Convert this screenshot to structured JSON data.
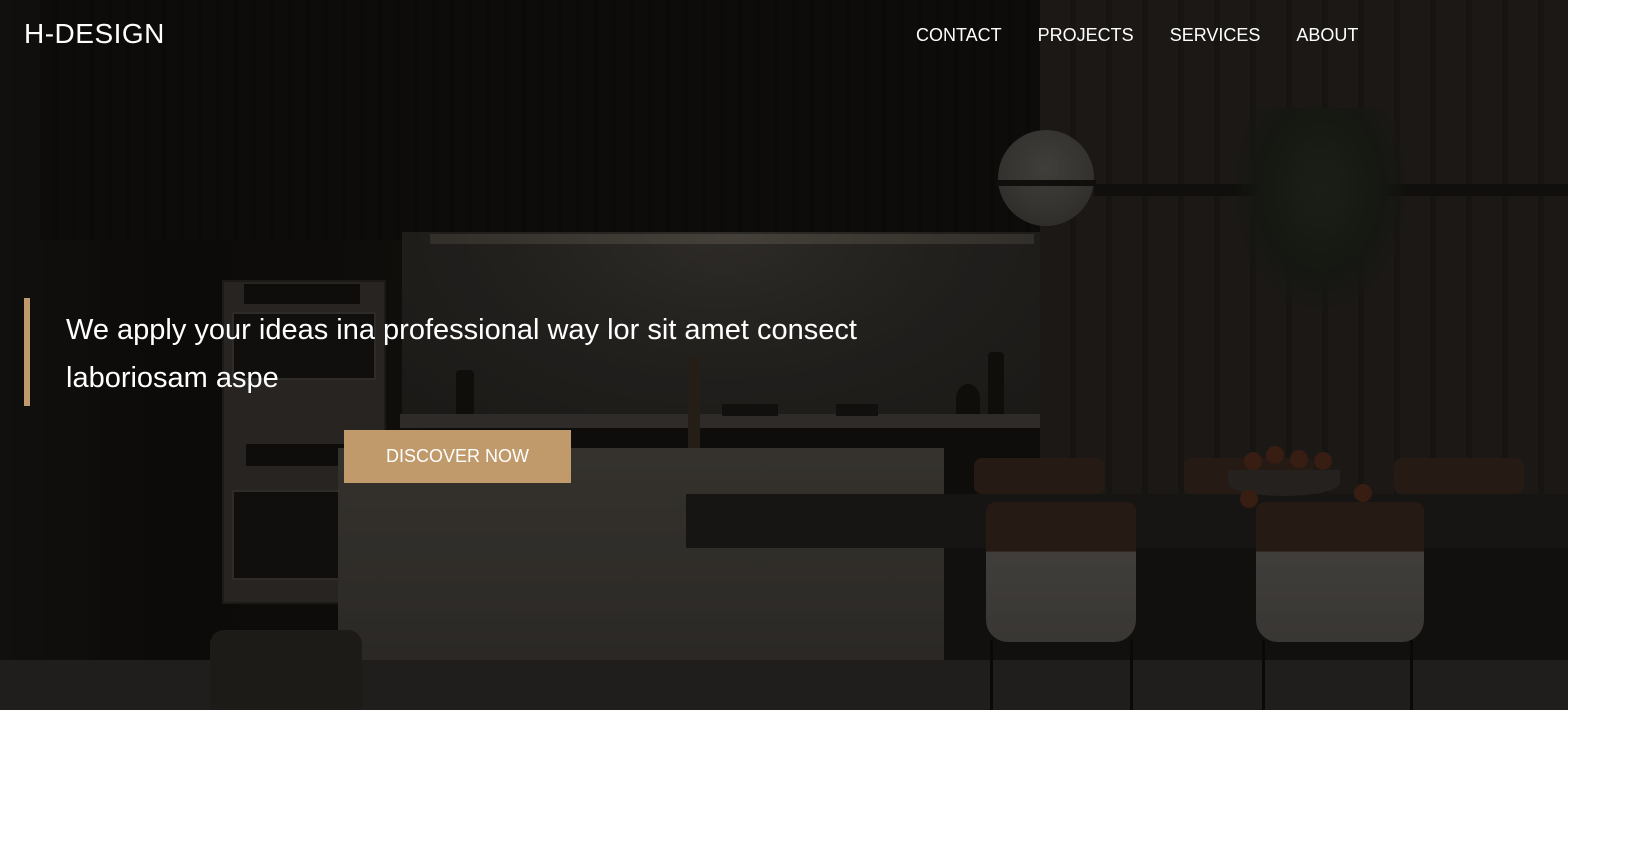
{
  "header": {
    "brand": "H-DESIGN",
    "nav": [
      {
        "label": "CONTACT"
      },
      {
        "label": "PROJECTS"
      },
      {
        "label": "SERVICES"
      },
      {
        "label": "ABOUT"
      }
    ]
  },
  "hero": {
    "headline": "We apply your ideas ina professional way lor sit amet consect laboriosam aspe",
    "cta_label": "DISCOVER NOW",
    "accent_color": "#c19a6b",
    "background_image": "dark-kitchen-interior-photo"
  }
}
